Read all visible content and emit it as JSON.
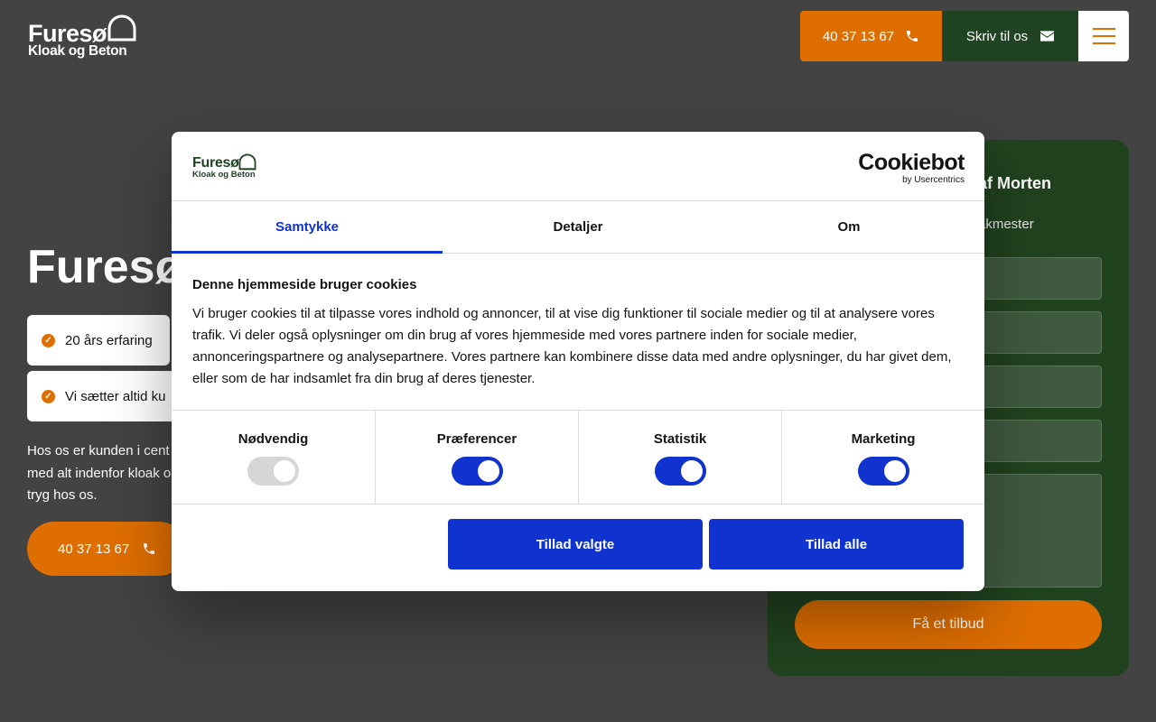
{
  "header": {
    "logo": {
      "line1": "Furesø",
      "line2": "Kloak og Beton"
    },
    "phone_label": "40 37 13 67",
    "write_label": "Skriv til os"
  },
  "hero": {
    "title": "Furesø",
    "badges": [
      "20 års erfaring",
      "Vi sætter altid ku"
    ],
    "text_lines": [
      "Hos os er kunden i cent",
      "med alt indenfor kloak o",
      "tryg hos os."
    ],
    "phone_label": "40 37 13 67"
  },
  "form": {
    "title": "af Morten",
    "subtitle": "åkmester",
    "submit_label": "Få et tilbud"
  },
  "cookie_dialog": {
    "logo": {
      "line1": "Furesø",
      "line2": "Kloak og Beton"
    },
    "brand_name": "Cookiebot",
    "brand_sub": "by Usercentrics",
    "tabs": [
      "Samtykke",
      "Detaljer",
      "Om"
    ],
    "active_tab": "Samtykke",
    "heading": "Denne hjemmeside bruger cookies",
    "body": "Vi bruger cookies til at tilpasse vores indhold og annoncer, til at vise dig funktioner til sociale medier og til at analysere vores trafik. Vi deler også oplysninger om din brug af vores hjemmeside med vores partnere inden for sociale medier, annonceringspartnere og analysepartnere. Vores partnere kan kombinere disse data med andre oplysninger, du har givet dem, eller som de har indsamlet fra din brug af deres tjenester.",
    "categories": [
      {
        "label": "Nødvendig",
        "checked": true,
        "disabled": true
      },
      {
        "label": "Præferencer",
        "checked": true,
        "disabled": false
      },
      {
        "label": "Statistik",
        "checked": true,
        "disabled": false
      },
      {
        "label": "Marketing",
        "checked": true,
        "disabled": false
      }
    ],
    "allow_selected_label": "Tillad valgte",
    "allow_all_label": "Tillad alle"
  },
  "colors": {
    "orange": "#df6e00",
    "dark_green": "#1f4323",
    "cookie_blue": "#1032cf",
    "background": "#434343"
  },
  "icons": [
    "phone-icon",
    "envelope-icon",
    "hamburger-menu-icon",
    "check-circle-icon"
  ]
}
